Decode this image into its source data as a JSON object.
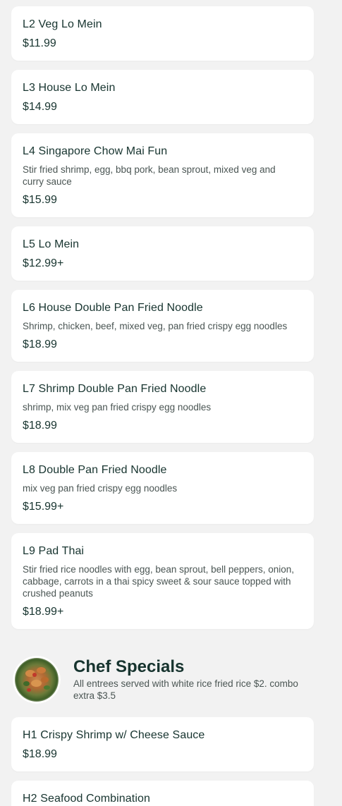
{
  "items": [
    {
      "name": "L2 Veg Lo Mein",
      "price": "$11.99"
    },
    {
      "name": "L3 House Lo Mein",
      "price": "$14.99"
    },
    {
      "name": "L4 Singapore Chow Mai Fun",
      "desc": "Stir fried shrimp, egg, bbq pork, bean sprout, mixed veg and curry sauce",
      "price": "$15.99"
    },
    {
      "name": "L5 Lo Mein",
      "price": "$12.99+"
    },
    {
      "name": "L6 House Double Pan Fried Noodle",
      "desc": "Shrimp, chicken, beef, mixed veg, pan fried crispy egg noodles",
      "price": "$18.99"
    },
    {
      "name": "L7 Shrimp Double Pan Fried Noodle",
      "desc": "shrimp, mix veg pan fried crispy egg noodles",
      "price": "$18.99"
    },
    {
      "name": "L8 Double Pan Fried Noodle",
      "desc": "mix veg pan fried crispy egg noodles",
      "price": "$15.99+"
    },
    {
      "name": "L9 Pad Thai",
      "desc": "Stir fried rice noodles with egg, bean sprout, bell peppers, onion, cabbage, carrots in a thai spicy sweet & sour sauce topped with crushed peanuts",
      "price": "$18.99+"
    }
  ],
  "section": {
    "title": "Chef Specials",
    "description": "All entrees served with white rice fried rice $2. combo extra $3.5"
  },
  "chef_items": [
    {
      "name": "H1 Crispy Shrimp w/ Cheese Sauce",
      "price": "$18.99"
    },
    {
      "name": "H2 Seafood Combination"
    }
  ]
}
